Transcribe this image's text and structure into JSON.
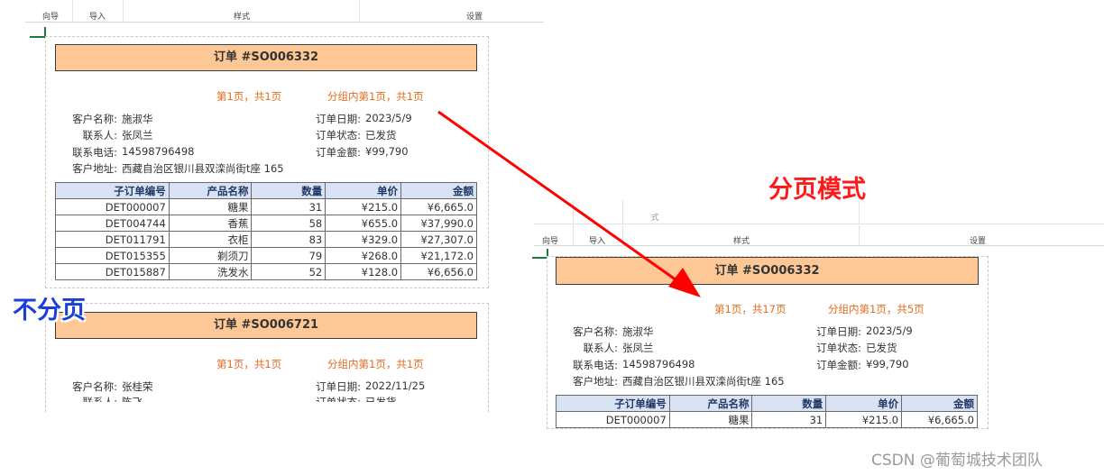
{
  "ribbon": {
    "dir": "向导",
    "import": "导入",
    "style": "样式",
    "settings": "设置"
  },
  "labels": {
    "single": "不分页",
    "paged": "分页模式"
  },
  "field_labels": {
    "customer": "客户名称:",
    "contact": "联系人:",
    "phone": "联系电话:",
    "address": "客户地址:",
    "order_date": "订单日期:",
    "status": "订单状态:",
    "amount": "订单金额:"
  },
  "table_headers": [
    "子订单编号",
    "产品名称",
    "数量",
    "单价",
    "金额"
  ],
  "left_order1": {
    "title": "订单 #SO006332",
    "page_info": "第1页，共1页",
    "group_info": "分组内第1页，共1页",
    "customer": "施淑华",
    "contact": "张凤兰",
    "phone": "14598796498",
    "address": "西藏自治区银川县双滦尚街t座 165",
    "order_date": "2023/5/9",
    "status": "已发货",
    "amount": "¥99,790",
    "rows": [
      [
        "DET000007",
        "糖果",
        "31",
        "¥215.0",
        "¥6,665.0"
      ],
      [
        "DET004744",
        "香蕉",
        "58",
        "¥655.0",
        "¥37,990.0"
      ],
      [
        "DET011791",
        "衣柜",
        "83",
        "¥329.0",
        "¥27,307.0"
      ],
      [
        "DET015355",
        "剃须刀",
        "79",
        "¥268.0",
        "¥21,172.0"
      ],
      [
        "DET015887",
        "洗发水",
        "52",
        "¥128.0",
        "¥6,656.0"
      ]
    ]
  },
  "left_order2": {
    "title": "订单 #SO006721",
    "page_info": "第1页，共1页",
    "group_info": "分组内第1页，共1页",
    "customer": "张桂荣",
    "contact": "陈飞",
    "order_date": "2022/11/25",
    "status": "已发货"
  },
  "right_order": {
    "title": "订单 #SO006332",
    "page_info": "第1页，共17页",
    "group_info": "分组内第1页，共5页",
    "customer": "施淑华",
    "contact": "张凤兰",
    "phone": "14598796498",
    "address": "西藏自治区银川县双滦尚街t座 165",
    "order_date": "2023/5/9",
    "status": "已发货",
    "amount": "¥99,790",
    "rows": [
      [
        "DET000007",
        "糖果",
        "31",
        "¥215.0",
        "¥6,665.0"
      ]
    ]
  },
  "right_ribbon_partial": "式",
  "watermark": "CSDN @葡萄城技术团队",
  "colors": {
    "title_fill": "#fdc896",
    "orange_text": "#e36c1e",
    "header_fill": "#d9e2f3",
    "arrow": "#ff0000"
  }
}
